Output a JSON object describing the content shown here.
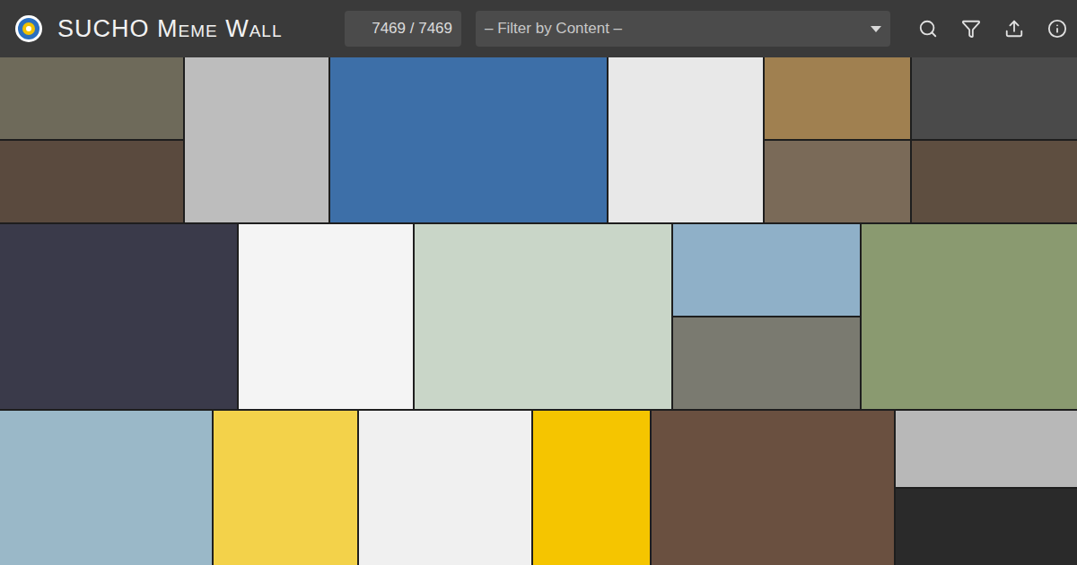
{
  "header": {
    "title": "SUCHO Meme Wall",
    "counter": "7469 / 7469",
    "filter": {
      "placeholder": "– Filter by Content –"
    }
  },
  "wall": {
    "rows": [
      [
        {
          "kind": "stack",
          "parts": [
            {
              "color": "#6e6a5a"
            },
            {
              "color": "#5a4a3e"
            }
          ]
        },
        {
          "kind": "single",
          "color": "#bdbdbd"
        },
        {
          "kind": "single",
          "color": "#3d6fa8"
        },
        {
          "kind": "single",
          "color": "#e8e8e8"
        },
        {
          "kind": "stack",
          "parts": [
            {
              "color": "#a08050"
            },
            {
              "color": "#7a6a58"
            }
          ]
        },
        {
          "kind": "stack",
          "parts": [
            {
              "color": "#4a4a4a"
            },
            {
              "color": "#5e4e40"
            }
          ]
        }
      ],
      [
        {
          "kind": "single",
          "color": "#3a3a4a"
        },
        {
          "kind": "single",
          "color": "#f4f4f4"
        },
        {
          "kind": "single",
          "color": "#c9d6c8"
        },
        {
          "kind": "stack",
          "parts": [
            {
              "color": "#8fb0c8"
            },
            {
              "color": "#7a7a70"
            }
          ]
        },
        {
          "kind": "single",
          "color": "#8a9a70"
        }
      ],
      [
        {
          "kind": "single",
          "color": "#9ab8c8"
        },
        {
          "kind": "single",
          "color": "#f3d24a"
        },
        {
          "kind": "single",
          "color": "#f0f0f0"
        },
        {
          "kind": "single",
          "color": "#f5c500"
        },
        {
          "kind": "single",
          "color": "#6a5040"
        },
        {
          "kind": "stack",
          "parts": [
            {
              "color": "#b8b8b8"
            },
            {
              "color": "#2a2a2a"
            }
          ]
        }
      ]
    ]
  }
}
